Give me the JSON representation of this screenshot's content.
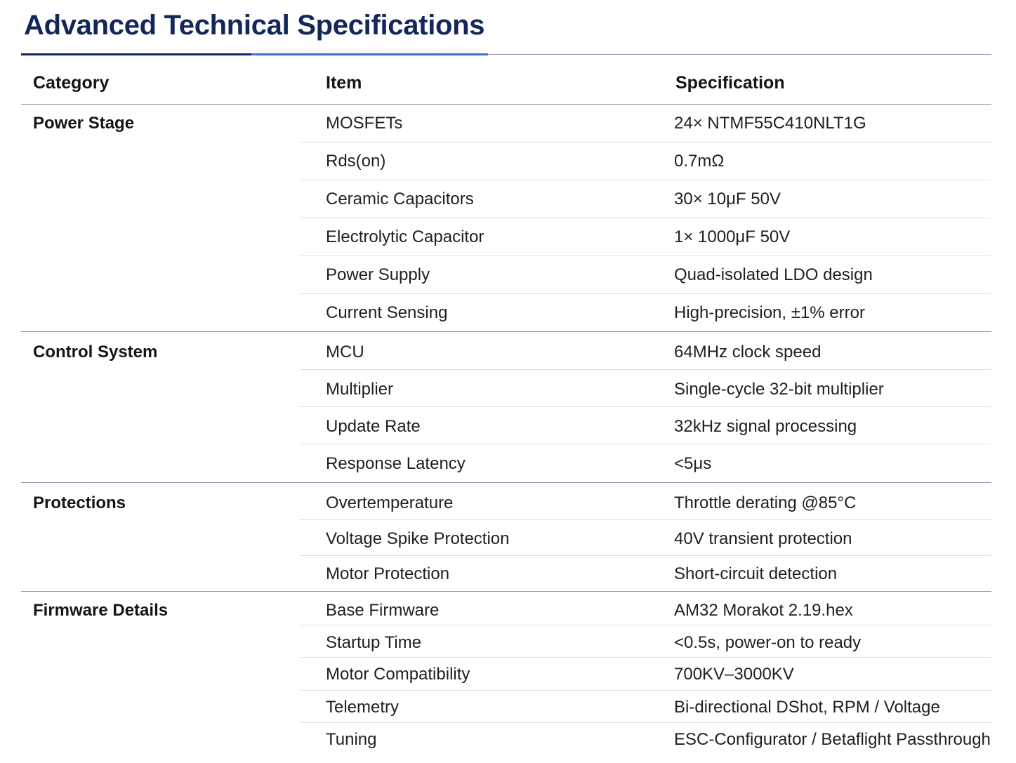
{
  "title": "Advanced Technical Specifications",
  "columns": {
    "category": "Category",
    "item": "Item",
    "specification": "Specification"
  },
  "groups": [
    {
      "category": "Power Stage",
      "rows": [
        {
          "item": "MOSFETs",
          "spec": "24× NTMF55C410NLT1G"
        },
        {
          "item": "Rds(on)",
          "spec": "0.7mΩ"
        },
        {
          "item": "Ceramic Capacitors",
          "spec": "30× 10μF 50V"
        },
        {
          "item": "Electrolytic Capacitor",
          "spec": "1× 1000μF 50V"
        },
        {
          "item": "Power Supply",
          "spec": "Quad-isolated LDO design"
        },
        {
          "item": "Current Sensing",
          "spec": "High-precision, ±1% error"
        }
      ]
    },
    {
      "category": "Control System",
      "rows": [
        {
          "item": "MCU",
          "spec": "64MHz clock speed"
        },
        {
          "item": "Multiplier",
          "spec": "Single-cycle 32-bit multiplier"
        },
        {
          "item": "Update Rate",
          "spec": "32kHz signal processing"
        },
        {
          "item": "Response Latency",
          "spec": "<5μs"
        }
      ]
    },
    {
      "category": "Protections",
      "rows": [
        {
          "item": "Overtemperature",
          "spec": "Throttle derating @85°C"
        },
        {
          "item": "Voltage Spike Protection",
          "spec": "40V transient protection"
        },
        {
          "item": "Motor Protection",
          "spec": "Short-circuit detection"
        }
      ]
    },
    {
      "category": "Firmware Details",
      "rows": [
        {
          "item": "Base Firmware",
          "spec": "AM32 Morakot 2.19.hex"
        },
        {
          "item": "Startup Time",
          "spec": "<0.5s, power-on to ready"
        },
        {
          "item": "Motor Compatibility",
          "spec": "700KV–3000KV"
        },
        {
          "item": "Telemetry",
          "spec": "Bi-directional DShot, RPM / Voltage"
        },
        {
          "item": "Tuning",
          "spec": "ESC-Configurator / Betaflight Passthrough"
        }
      ]
    }
  ]
}
